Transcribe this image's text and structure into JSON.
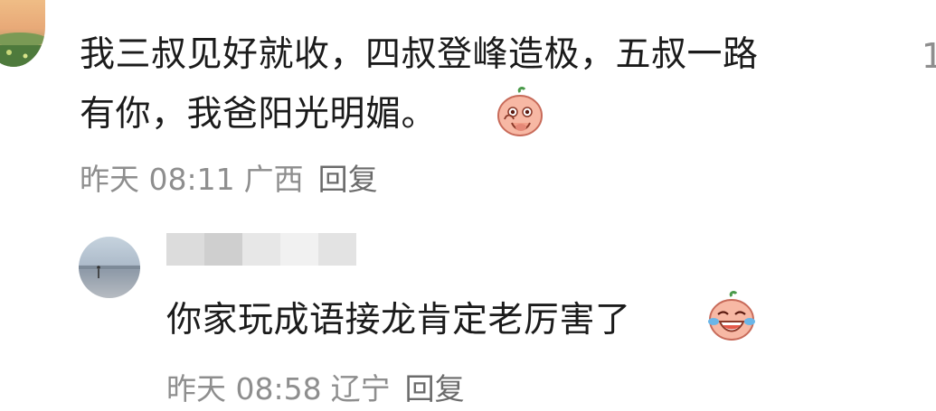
{
  "comment": {
    "line1": "我三叔见好就收，四叔登峰造极，五叔一路",
    "line2": "有你，我爸阳光明媚。",
    "emoji": "peach-smirk-emoji",
    "time": "昨天 08:11",
    "location": "广西",
    "reply_label": "回复",
    "like_count": "1"
  },
  "reply": {
    "username_blurred": true,
    "text": "你家玩成语接龙肯定老厉害了",
    "emoji": "peach-laugh-cry-emoji",
    "time": "昨天 08:58",
    "location": "辽宁",
    "reply_label": "回复"
  },
  "colors": {
    "text": "#1b1b1b",
    "meta": "#8e8e8e"
  }
}
